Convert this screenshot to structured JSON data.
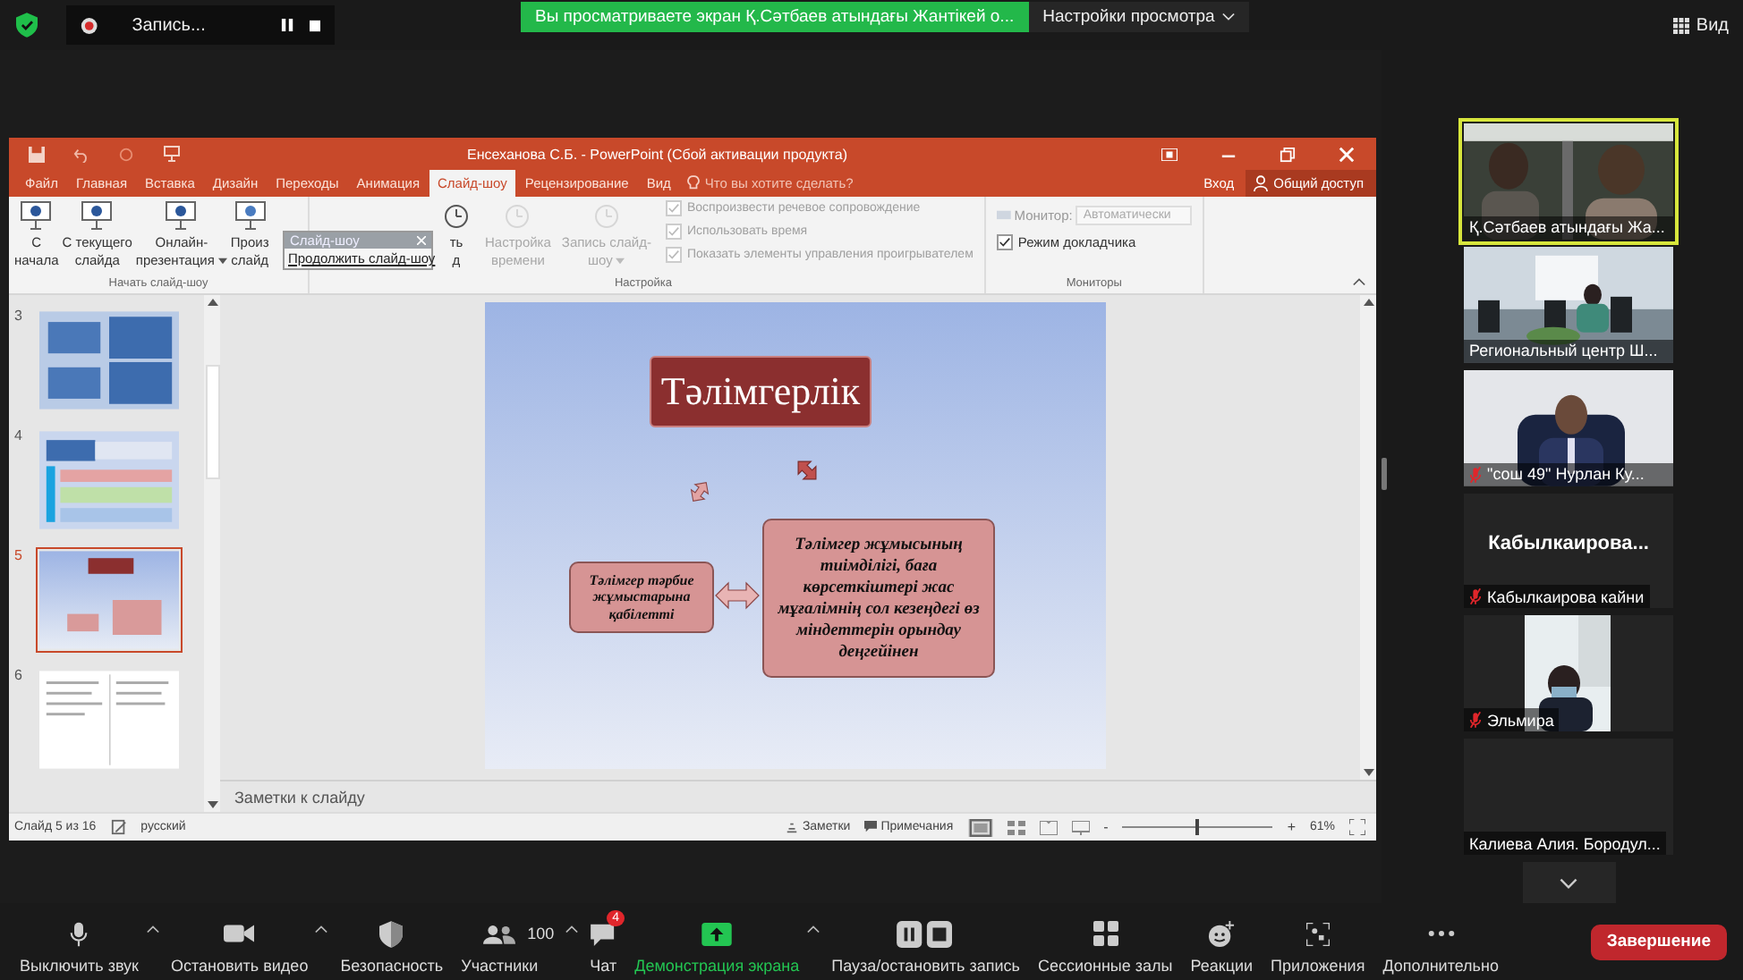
{
  "top_bar": {
    "recording": {
      "label": "Запись..."
    },
    "banner": "Вы просматриваете экран Қ.Сәтбаев атындағы Жантікей о...",
    "view_settings": "Настройки просмотра",
    "view": "Вид"
  },
  "powerpoint": {
    "title": "Енсеханова С.Б. - PowerPoint (Сбой активации продукта)",
    "tabs": [
      {
        "label": "Файл",
        "selected": false
      },
      {
        "label": "Главная",
        "selected": false
      },
      {
        "label": "Вставка",
        "selected": false
      },
      {
        "label": "Дизайн",
        "selected": false
      },
      {
        "label": "Переходы",
        "selected": false
      },
      {
        "label": "Анимация",
        "selected": false
      },
      {
        "label": "Слайд-шоу",
        "selected": true
      },
      {
        "label": "Рецензирование",
        "selected": false
      },
      {
        "label": "Вид",
        "selected": false
      }
    ],
    "search": {
      "placeholder": "Что вы хотите сделать?"
    },
    "sign_in": "Вход",
    "share": "Общий доступ",
    "ribbon": {
      "start_group": {
        "label": "Начать слайд-шоу",
        "buttons": [
          {
            "lines": [
              "С",
              "начала"
            ],
            "disabled": false
          },
          {
            "lines": [
              "С текущего",
              "слайда"
            ],
            "disabled": false
          },
          {
            "lines": [
              "Онлайн-",
              "презентация"
            ],
            "caret": true,
            "disabled": false
          },
          {
            "lines": [
              "Произ",
              "слайд"
            ],
            "disabled": false
          }
        ]
      },
      "setup_group": {
        "label": "Настройка",
        "buttons": [
          {
            "lines": [
              "ть",
              "д"
            ],
            "disabled": false
          },
          {
            "lines": [
              "Настройка",
              "времени"
            ],
            "disabled": true
          },
          {
            "lines": [
              "Запись слайд-",
              "шоу"
            ],
            "caret": true,
            "disabled": true
          }
        ],
        "checkboxes": [
          {
            "label": "Воспроизвести речевое сопровождение",
            "checked": true,
            "disabled": true
          },
          {
            "label": "Использовать время",
            "checked": true,
            "disabled": true
          },
          {
            "label": "Показать элементы управления проигрывателем",
            "checked": true,
            "disabled": true
          }
        ]
      },
      "monitors_group": {
        "label": "Мониторы",
        "monitor_label": "Монитор:",
        "monitor_value": "Автоматически",
        "presenter": {
          "label": "Режим докладчика",
          "checked": true,
          "disabled": false
        }
      }
    },
    "popup": {
      "title": "Слайд-шоу",
      "item": "Продолжить слайд-шоу"
    },
    "thumbnails": [
      {
        "number": "3",
        "selected": false
      },
      {
        "number": "4",
        "selected": false
      },
      {
        "number": "5",
        "selected": true
      },
      {
        "number": "6",
        "selected": false
      }
    ],
    "slide": {
      "title": "Тәлімгерлік",
      "left_box": "Тәлімгер тәрбие жұмыстарына қабілетті",
      "right_box": "Тәлімгер жұмысының тиімділігі, баға көрсеткіштері жас мұғалімнің сол кезеңдегі өз міндеттерін орындау деңгейінен"
    },
    "notes_placeholder": "Заметки к слайду",
    "status_bar": {
      "slide": "Слайд 5 из 16",
      "language": "русский",
      "notes": "Заметки",
      "comments": "Примечания",
      "zoom_out": "-",
      "zoom_in": "+",
      "zoom": {
        "level": 0.5
      },
      "zoom_value": "61%"
    }
  },
  "gallery": [
    {
      "kind": "video",
      "name": "Қ.Сәтбаев атындағы Жа...",
      "muted": false,
      "active": true
    },
    {
      "kind": "video",
      "name": "Региональный центр Ш...",
      "muted": false,
      "active": false
    },
    {
      "kind": "video",
      "name": "\"сош 49\" Нурлан Ку...",
      "muted": true,
      "active": false
    },
    {
      "kind": "name",
      "display": "Кабылкаирова...",
      "name": "Кабылкаирова кайни",
      "muted": true,
      "active": false
    },
    {
      "kind": "small_video",
      "name": "Эльмира",
      "muted": true,
      "active": false
    },
    {
      "kind": "blank",
      "name": "Калиева Алия. Бородул...",
      "muted": false,
      "active": false
    }
  ],
  "toolbar": [
    {
      "label": "Выключить звук",
      "caret": true
    },
    {
      "label": "Остановить видео",
      "caret": true
    },
    {
      "label": "Безопасность"
    },
    {
      "label": "Участники",
      "count": "100",
      "caret": true
    },
    {
      "label": "Чат",
      "badge": "4"
    },
    {
      "label": "Демонстрация экрана",
      "caret": true,
      "highlight": true
    },
    {
      "label": "Пауза/остановить запись"
    },
    {
      "label": "Сессионные залы"
    },
    {
      "label": "Реакции"
    },
    {
      "label": "Приложения"
    },
    {
      "label": "Дополнительно"
    }
  ],
  "end_button": "Завершение"
}
